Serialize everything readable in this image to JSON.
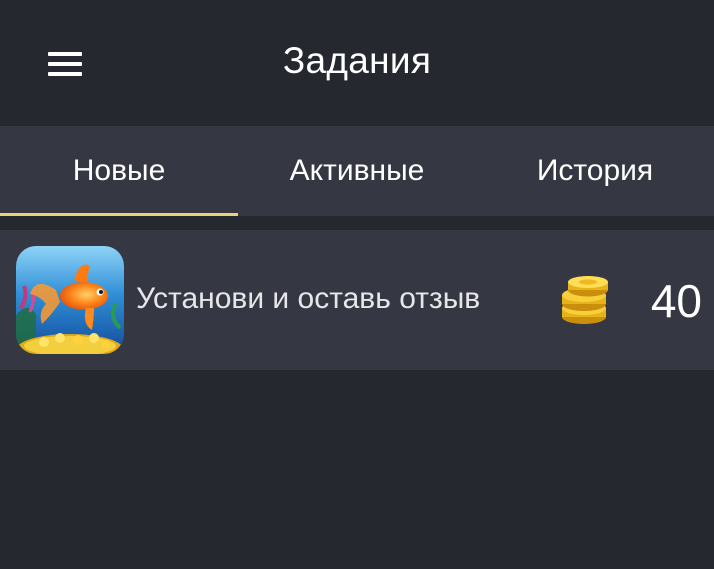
{
  "header": {
    "title": "Задания",
    "menu_icon": "hamburger-menu-icon"
  },
  "tabs": [
    {
      "label": "Новые",
      "active": true
    },
    {
      "label": "Активные",
      "active": false
    },
    {
      "label": "История",
      "active": false
    }
  ],
  "tasks": [
    {
      "icon": "goldfish-app-icon",
      "text": "Установи и оставь отзыв",
      "reward_icon": "coins-icon",
      "reward": "40"
    }
  ],
  "colors": {
    "background": "#262830",
    "surface": "#353843",
    "tab_indicator": "#e7d37a",
    "coin": "#f2c230"
  }
}
